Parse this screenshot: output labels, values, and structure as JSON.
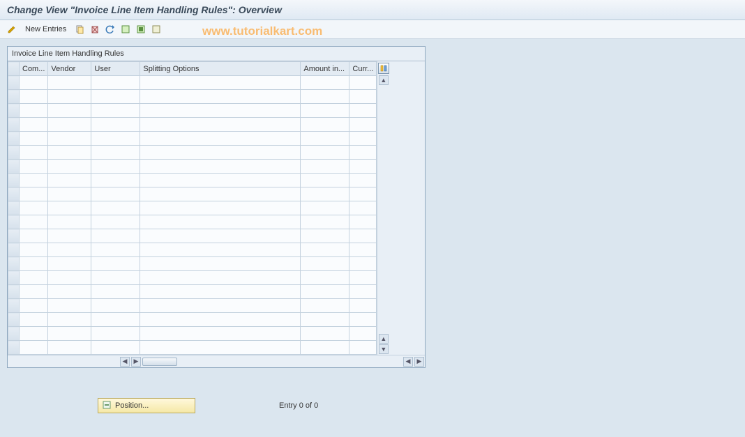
{
  "title": "Change View \"Invoice Line Item Handling Rules\": Overview",
  "toolbar": {
    "new_entries_label": "New Entries"
  },
  "watermark": "www.tutorialkart.com",
  "panel": {
    "caption": "Invoice Line Item Handling Rules",
    "columns": {
      "com": "Com...",
      "vendor": "Vendor",
      "user": "User",
      "splitting": "Splitting Options",
      "amount": "Amount in...",
      "curr": "Curr..."
    }
  },
  "footer": {
    "position_label": "Position...",
    "entry_text": "Entry 0 of 0"
  }
}
